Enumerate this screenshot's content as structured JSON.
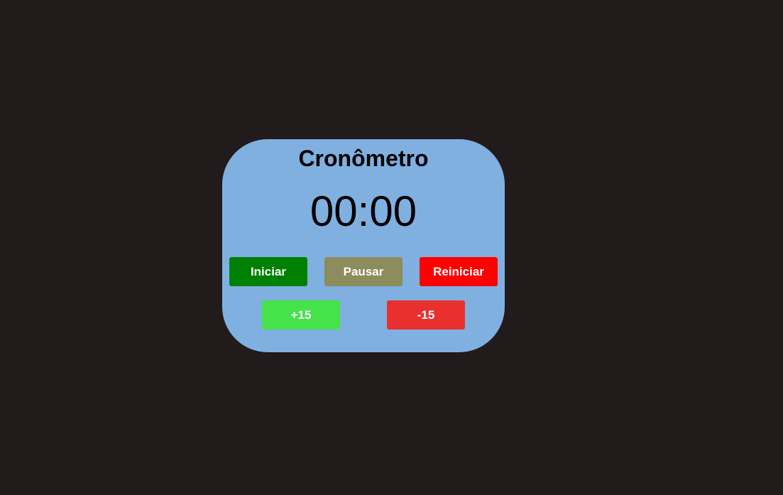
{
  "stopwatch": {
    "title": "Cronômetro",
    "time": "00:00"
  },
  "buttons": {
    "start": {
      "label": "Iniciar",
      "color": "#008000"
    },
    "pause": {
      "label": "Pausar",
      "color": "#8c8c5c"
    },
    "reset": {
      "label": "Reiniciar",
      "color": "#ff0000"
    },
    "plus15": {
      "label": "+15",
      "color": "#45e24a"
    },
    "minus15": {
      "label": "-15",
      "color": "#ea2f2f"
    }
  },
  "colors": {
    "background": "#211b1c",
    "card": "#80b0e0",
    "text": "#000000",
    "button_text": "#ffffff"
  }
}
